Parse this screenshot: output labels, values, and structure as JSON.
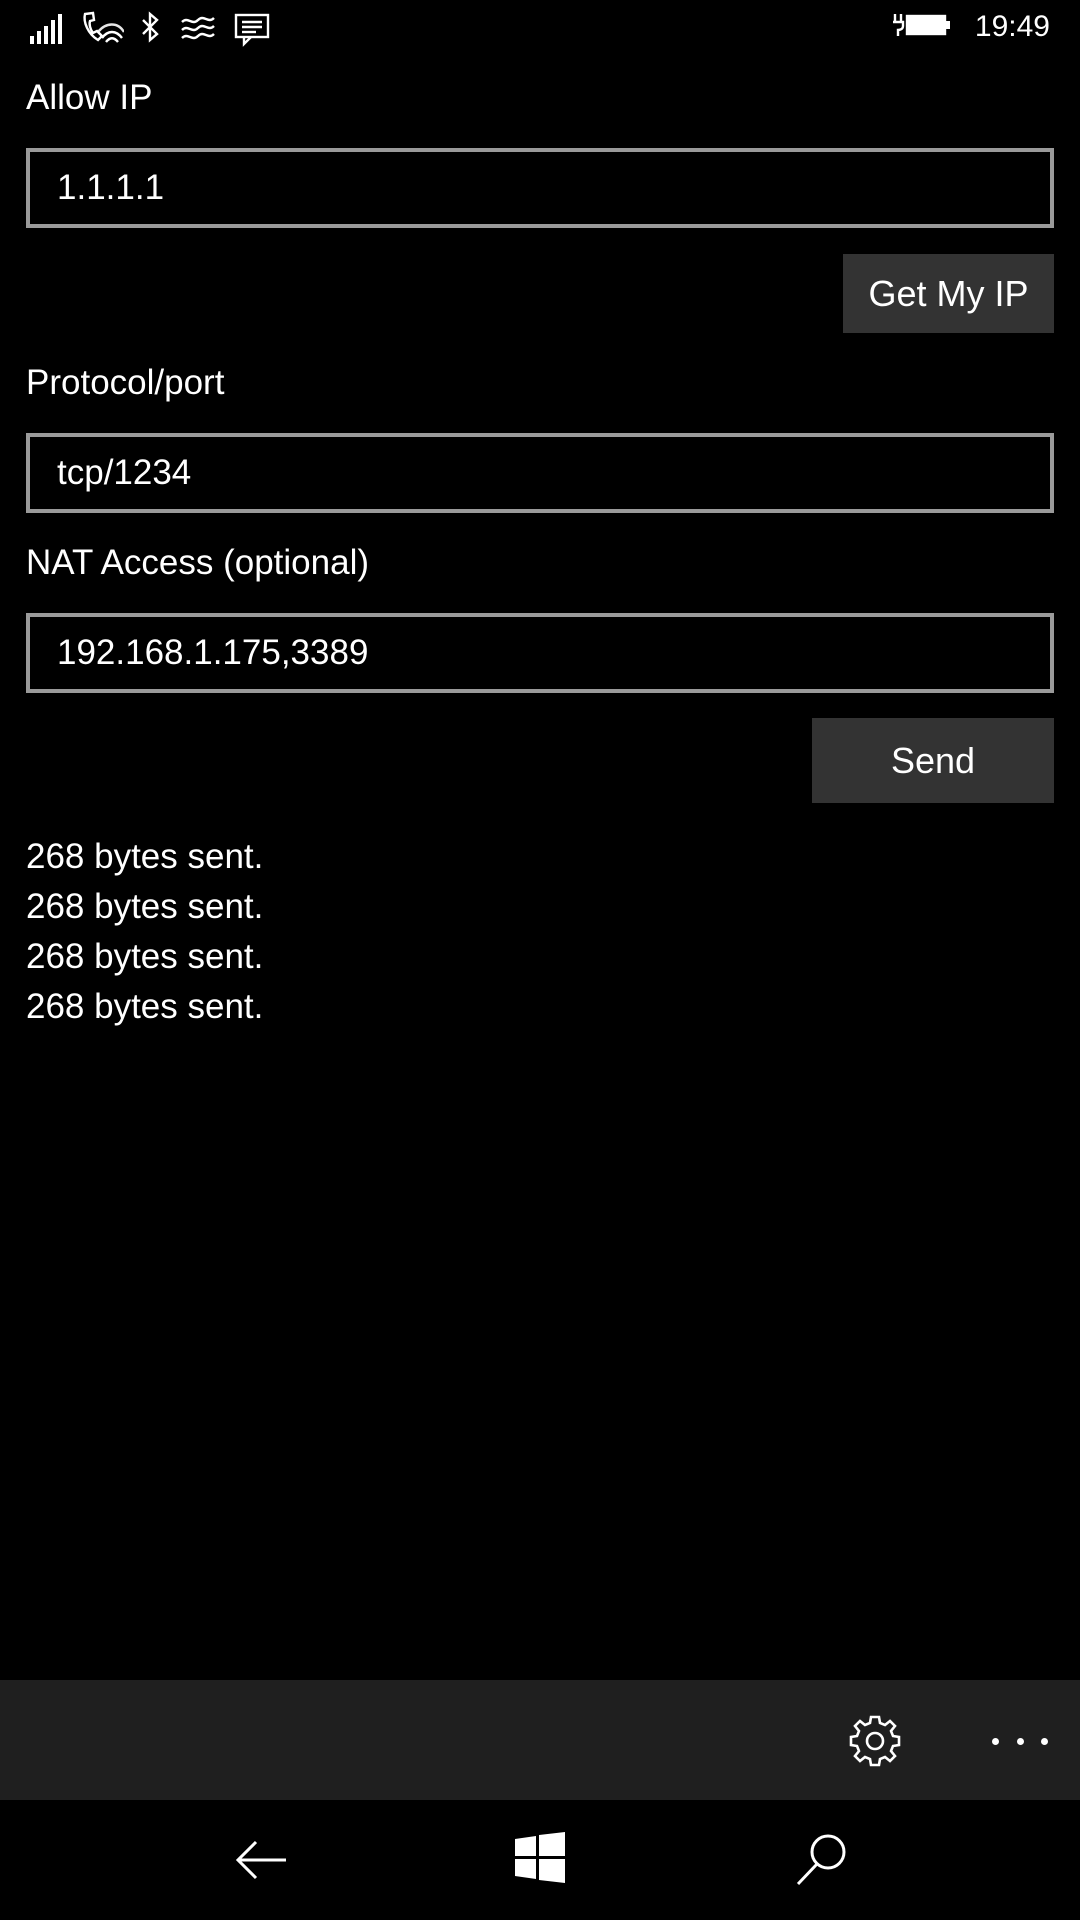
{
  "status_bar": {
    "time": "19:49",
    "icons": [
      "signal-icon",
      "wifi-calling-icon",
      "bluetooth-icon",
      "hotspot-icon",
      "notification-icon",
      "battery-charging-icon"
    ]
  },
  "form": {
    "allow_ip": {
      "label": "Allow IP",
      "value": "1.1.1.1"
    },
    "get_my_ip_label": "Get My IP",
    "protocol_port": {
      "label": "Protocol/port",
      "value": "tcp/1234"
    },
    "nat_access": {
      "label": "NAT Access (optional)",
      "value": "192.168.1.175,3389"
    },
    "send_label": "Send"
  },
  "log": [
    "268 bytes sent.",
    "268 bytes sent.",
    "268 bytes sent.",
    "268 bytes sent."
  ],
  "app_bar": {
    "icons": [
      "settings-icon",
      "more-icon"
    ]
  },
  "nav_bar": {
    "icons": [
      "back-icon",
      "windows-start-icon",
      "search-icon"
    ]
  }
}
